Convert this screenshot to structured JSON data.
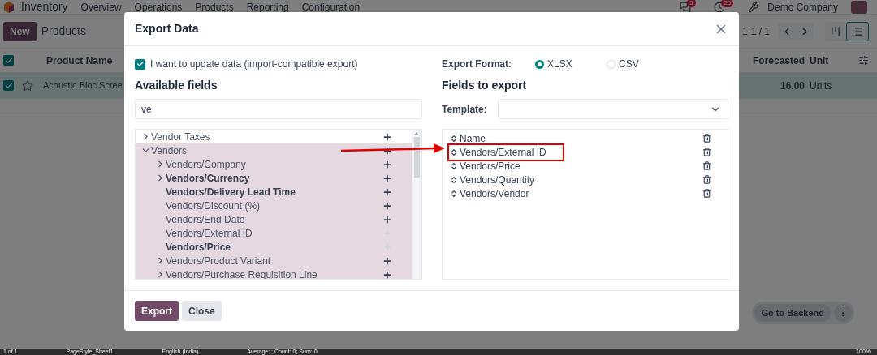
{
  "navbar": {
    "app": "Inventory",
    "menu": [
      "Overview",
      "Operations",
      "Products",
      "Reporting",
      "Configuration"
    ],
    "messages_badge": "5",
    "activities_badge": "25",
    "company": "Demo Company"
  },
  "control_panel": {
    "new_button": "New",
    "title": "Products",
    "pager": "1-1 / 1"
  },
  "table": {
    "header_checked": true,
    "columns": [
      "Product Name",
      "Forecasted",
      "Unit"
    ],
    "rows": [
      {
        "checked": true,
        "selected": true,
        "name": "Acoustic Bloc Scree",
        "forecasted": "16.00",
        "unit": "Units"
      }
    ]
  },
  "dialog": {
    "title": "Export Data",
    "import_compatible": {
      "label": "I want to update data (import-compatible export)",
      "checked": true
    },
    "available_heading": "Available fields",
    "search_value": "ve",
    "available_fields": [
      {
        "label": "Vendor Taxes",
        "kind": "relation",
        "expanded": false,
        "bold": false,
        "added": false
      },
      {
        "label": "Vendors",
        "kind": "relation",
        "expanded": true,
        "bold": false,
        "added": false,
        "children": [
          {
            "label": "Vendors/Company",
            "kind": "relation",
            "expanded": false,
            "bold": false,
            "added": false
          },
          {
            "label": "Vendors/Currency",
            "kind": "relation",
            "expanded": false,
            "bold": true,
            "added": false
          },
          {
            "label": "Vendors/Delivery Lead Time",
            "kind": "field",
            "bold": true,
            "added": false
          },
          {
            "label": "Vendors/Discount (%)",
            "kind": "field",
            "bold": false,
            "added": false
          },
          {
            "label": "Vendors/End Date",
            "kind": "field",
            "bold": false,
            "added": false
          },
          {
            "label": "Vendors/External ID",
            "kind": "field",
            "bold": false,
            "added": true
          },
          {
            "label": "Vendors/Price",
            "kind": "field",
            "bold": true,
            "added": true
          },
          {
            "label": "Vendors/Product Variant",
            "kind": "relation",
            "expanded": false,
            "bold": false,
            "added": false
          },
          {
            "label": "Vendors/Purchase Requisition Line",
            "kind": "relation",
            "expanded": false,
            "bold": false,
            "added": false
          }
        ]
      }
    ],
    "format_label": "Export Format:",
    "formats": [
      {
        "label": "XLSX",
        "selected": true
      },
      {
        "label": "CSV",
        "selected": false
      }
    ],
    "export_heading": "Fields to export",
    "template_label": "Template:",
    "export_fields": [
      {
        "label": "Name",
        "highlighted": false
      },
      {
        "label": "Vendors/External ID",
        "highlighted": true
      },
      {
        "label": "Vendors/Price",
        "highlighted": false
      },
      {
        "label": "Vendors/Quantity",
        "highlighted": false
      },
      {
        "label": "Vendors/Vendor",
        "highlighted": false
      }
    ],
    "buttons": [
      {
        "label": "Export",
        "kind": "primary"
      },
      {
        "label": "Close",
        "kind": "secondary"
      }
    ]
  },
  "backend_button": "Go to Backend",
  "status_bar": [
    "1 of 1",
    "PageStyle_Sheet1",
    "English (India)",
    "Average: ; Count: 0; Sum: 0",
    "100%"
  ]
}
